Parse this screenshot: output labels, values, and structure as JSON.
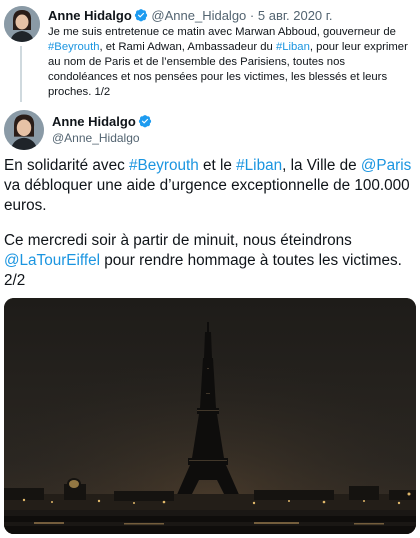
{
  "tweet_parent": {
    "author_name": "Anne Hidalgo",
    "author_handle": "@Anne_Hidalgo",
    "separator": "·",
    "date": "5 авг. 2020 г.",
    "text_1": "Je me suis entretenue ce matin avec Marwan Abboud, gouverneur de ",
    "link_1": "#Beyrouth",
    "text_2": ", et Rami Adwan, Ambassadeur du ",
    "link_2": "#Liban",
    "text_3": ", pour leur exprimer au nom de Paris et de l’ensemble des Parisiens, toutes nos condoléances et nos pensées pour les victimes, les blessés et leurs proches. 1/2"
  },
  "tweet_main": {
    "author_name": "Anne Hidalgo",
    "author_handle": "@Anne_Hidalgo",
    "p1_text_1": "En solidarité avec ",
    "p1_link_1": "#Beyrouth",
    "p1_text_2": " et le  ",
    "p1_link_2": "#Liban",
    "p1_text_3": ", la Ville de ",
    "p1_link_3": "@Paris",
    "p1_text_4": " va débloquer une aide d’urgence exceptionnelle de 100.000 euros.",
    "p2_text_1": "Ce mercredi soir à partir de minuit, nous éteindrons ",
    "p2_link_1": "@LaTourEiffel",
    "p2_text_2": " pour rendre hommage à toutes les victimes. 2/2",
    "photo_subject": "Eiffel Tower with lights switched off at night"
  },
  "icons": {
    "verified": "verified-badge-icon",
    "avatar": "profile-photo-avatar"
  },
  "colors": {
    "link": "#1b95e0",
    "verified": "#1d9bf0",
    "thread_line": "#cfd9de",
    "muted": "#536471"
  }
}
